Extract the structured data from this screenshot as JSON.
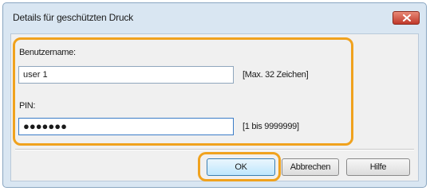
{
  "window": {
    "title": "Details für geschützten Druck",
    "close_icon": "close-icon"
  },
  "form": {
    "username": {
      "label": "Benutzername:",
      "value": "user 1",
      "hint": "[Max. 32 Zeichen]"
    },
    "pin": {
      "label": "PIN:",
      "masked_value": "●●●●●●●",
      "hint": "[1 bis 9999999]"
    }
  },
  "buttons": {
    "ok": "OK",
    "cancel": "Abbrechen",
    "help": "Hilfe"
  },
  "colors": {
    "highlight": "#f0a21e",
    "close_button": "#c0392b"
  }
}
